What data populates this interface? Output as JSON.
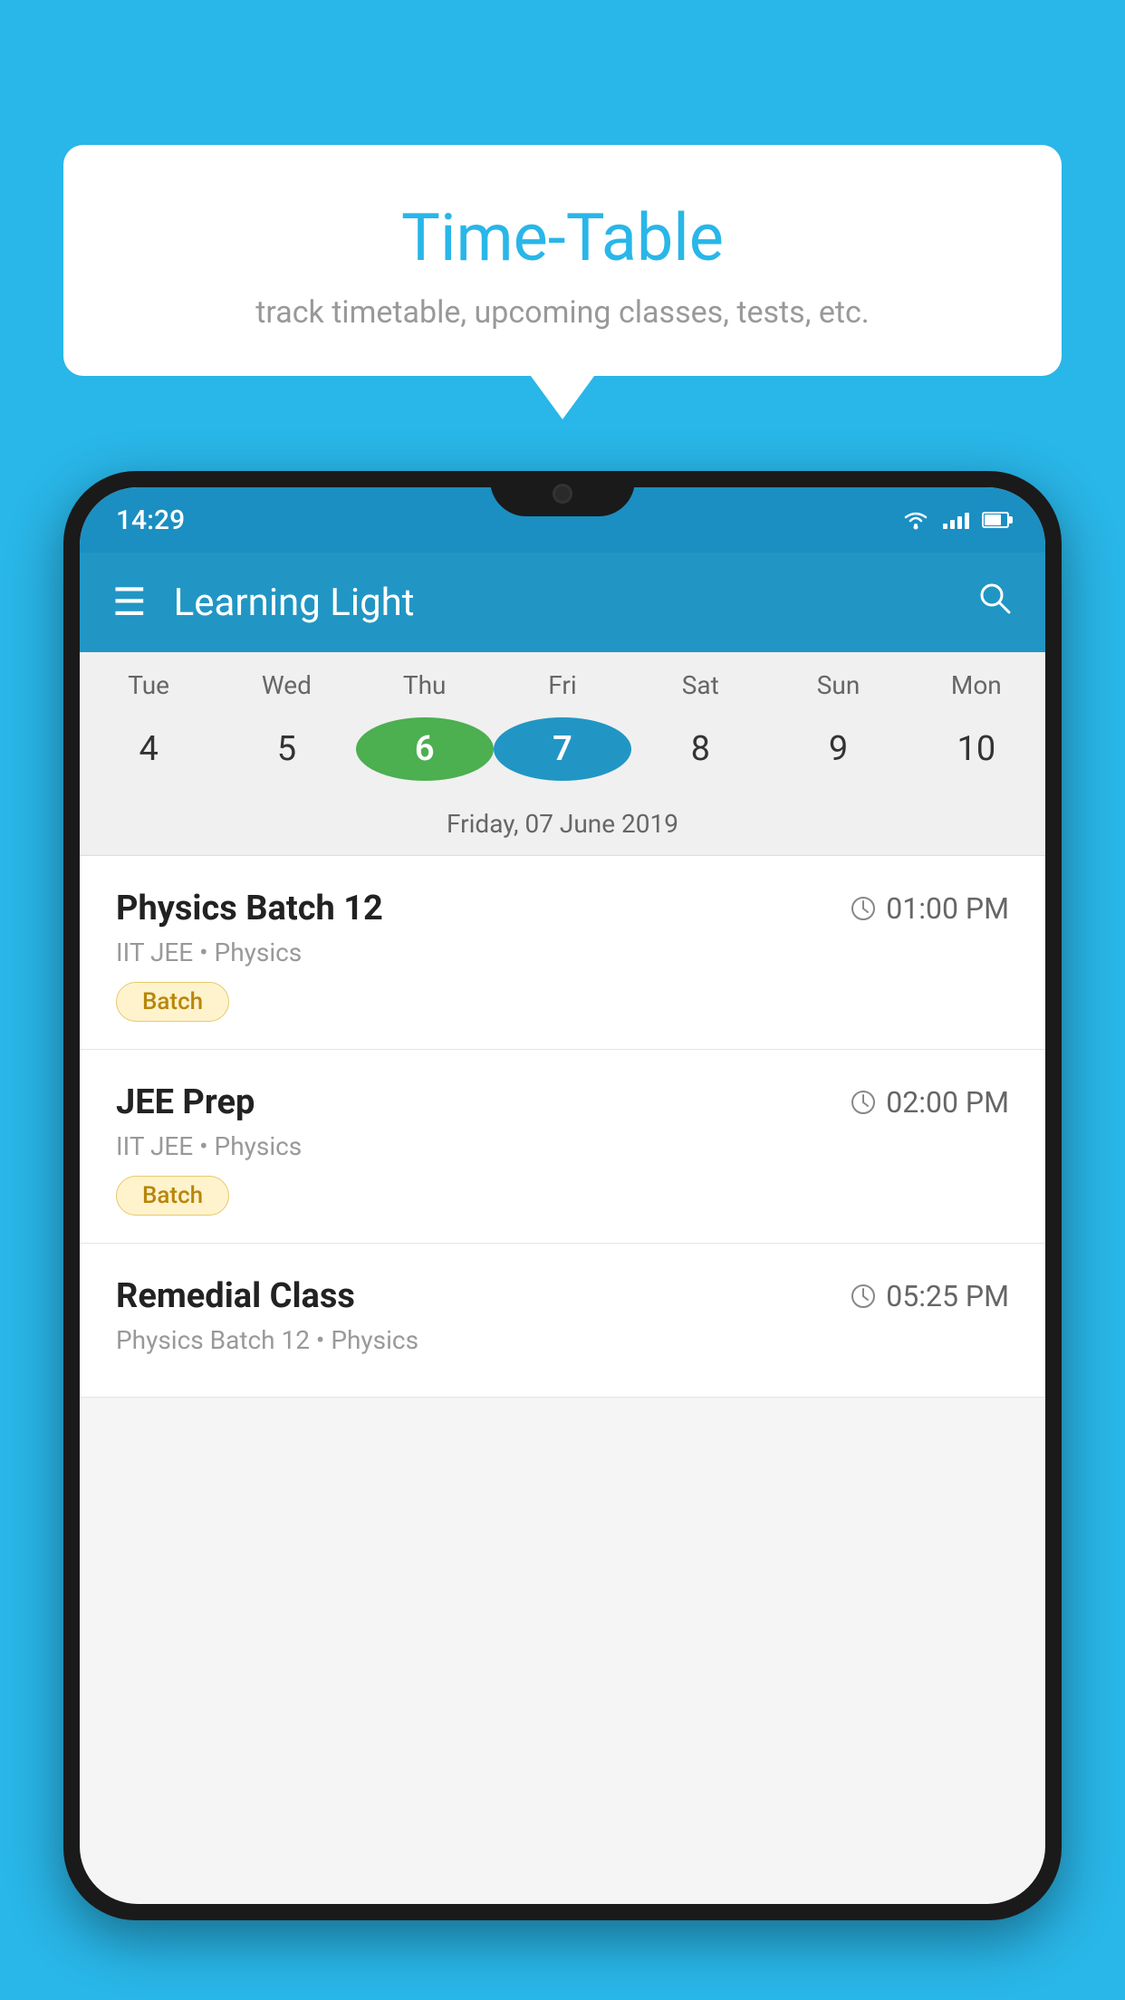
{
  "background_color": "#29b6e8",
  "speech_bubble": {
    "title": "Time-Table",
    "subtitle": "track timetable, upcoming classes, tests, etc."
  },
  "phone": {
    "status_bar": {
      "time": "14:29"
    },
    "app_bar": {
      "title": "Learning Light"
    },
    "calendar": {
      "days": [
        {
          "label": "Tue",
          "number": "4"
        },
        {
          "label": "Wed",
          "number": "5"
        },
        {
          "label": "Thu",
          "number": "6",
          "state": "today"
        },
        {
          "label": "Fri",
          "number": "7",
          "state": "selected"
        },
        {
          "label": "Sat",
          "number": "8"
        },
        {
          "label": "Sun",
          "number": "9"
        },
        {
          "label": "Mon",
          "number": "10"
        }
      ],
      "date_label": "Friday, 07 June 2019"
    },
    "schedule": [
      {
        "title": "Physics Batch 12",
        "time": "01:00 PM",
        "subtitle": "IIT JEE • Physics",
        "tag": "Batch"
      },
      {
        "title": "JEE Prep",
        "time": "02:00 PM",
        "subtitle": "IIT JEE • Physics",
        "tag": "Batch"
      },
      {
        "title": "Remedial Class",
        "time": "05:25 PM",
        "subtitle": "Physics Batch 12 • Physics",
        "tag": null
      }
    ]
  }
}
